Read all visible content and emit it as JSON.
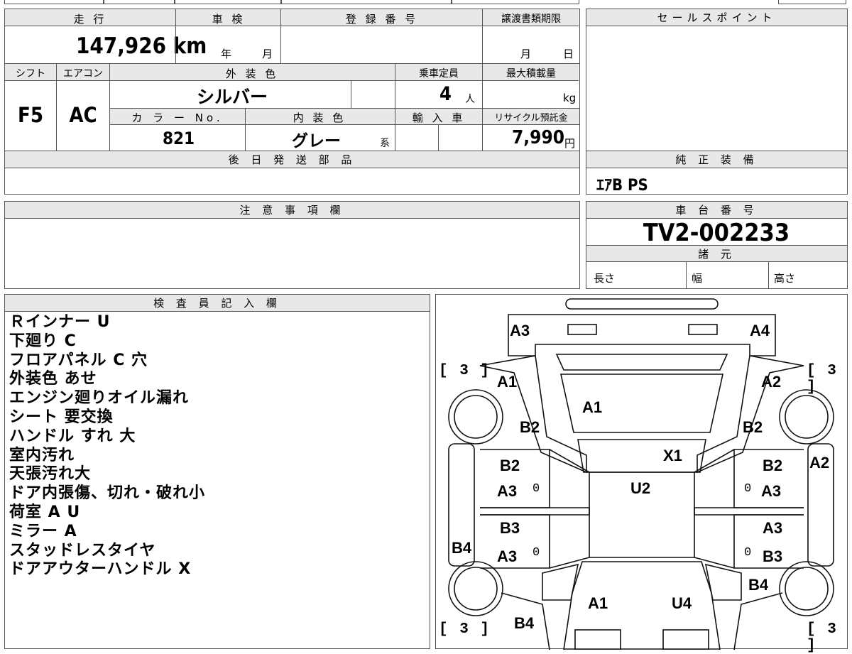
{
  "vehicle": {
    "mileage_label": "走 行",
    "mileage": "147,926 km",
    "inspection_label": "車 検",
    "inspection_year_unit": "年",
    "inspection_month_unit": "月",
    "registration_label": "登 録 番 号",
    "transfer_deadline_label": "譲渡書類期限",
    "transfer_month_unit": "月",
    "transfer_day_unit": "日",
    "shift_label": "シフト",
    "shift": "F5",
    "ac_label": "エアコン",
    "ac": "AC",
    "exterior_color_label": "外 装 色",
    "exterior_color": "シルバー",
    "capacity_label": "乗車定員",
    "capacity": "4",
    "capacity_unit": "人",
    "max_load_label": "最大積載量",
    "max_load_unit": "kg",
    "color_no_label": "カ ラ ー No.",
    "color_no": "821",
    "interior_color_label": "内 装 色",
    "interior_color": "グレー",
    "interior_suffix": "系",
    "import_label": "輸 入 車",
    "recycle_label": "リサイクル預託金",
    "recycle_fee": "7,990",
    "recycle_unit": "円"
  },
  "later_parts_label": "後 日 発 送 部 品",
  "sales_point_label": "セールスポイント",
  "standard_equipment_label": "純 正 装 備",
  "standard_equipment": "ｴｱB PS",
  "notes_label": "注 意 事 項 欄",
  "chassis_label": "車 台 番 号",
  "chassis_number": "TV2-002233",
  "specs_label": "諸 元",
  "specs": {
    "length": "長さ",
    "width": "幅",
    "height": "高さ"
  },
  "inspector_label": "検 査 員 記 入 欄",
  "inspector_notes": [
    "Ｒインナー U",
    "下廻り C",
    "フロアパネル C 穴",
    "外装色 あせ",
    "エンジン廻りオイル漏れ",
    "シート 要交換",
    "ハンドル すれ 大",
    "室内汚れ",
    "天張汚れ大",
    "ドア内張傷、切れ・破れ小",
    "荷室 A U",
    "ミラー A",
    "スタッドレスタイヤ",
    "ドアアウターハンドル X"
  ],
  "diagram": {
    "tire_tread": [
      "[ 3 ]",
      "[ 3 ]",
      "[ 3 ]",
      "[ 3 ]"
    ],
    "marks": [
      "A3",
      "A4",
      "A1",
      "A2",
      "A1",
      "B2",
      "B2",
      "X1",
      "B2",
      "B2",
      "A2",
      "A3",
      "U2",
      "A3",
      "B3",
      "A3",
      "B4",
      "A3",
      "B3",
      "B4",
      "A1",
      "U4",
      "B4",
      "0",
      "0",
      "0",
      "0"
    ]
  }
}
